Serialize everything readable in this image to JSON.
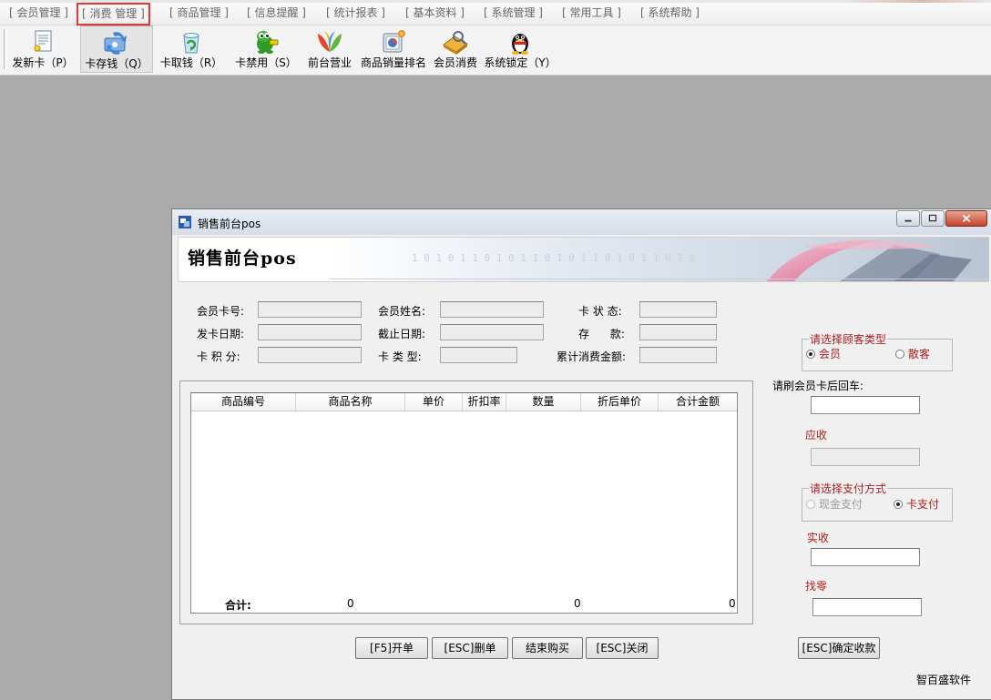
{
  "menu": [
    {
      "label": "[ 会员管理 ]",
      "active": false
    },
    {
      "label": "[ 消费 管理 ]",
      "active": true
    },
    {
      "label": "[ 商品管理 ]",
      "active": false
    },
    {
      "label": "[ 信息提醒 ]",
      "active": false
    },
    {
      "label": "[ 统计报表 ]",
      "active": false
    },
    {
      "label": "[ 基本资料 ]",
      "active": false
    },
    {
      "label": "[ 系统管理 ]",
      "active": false
    },
    {
      "label": "[ 常用工具 ]",
      "active": false
    },
    {
      "label": "[ 系统帮助 ]",
      "active": false
    }
  ],
  "toolbar": [
    {
      "label": "发新卡（P）",
      "icon": "new-card-icon"
    },
    {
      "label": "卡存钱（Q）",
      "icon": "card-deposit-icon"
    },
    {
      "label": "卡取钱（R）",
      "icon": "card-withdraw-icon"
    },
    {
      "label": "卡禁用（S）",
      "icon": "card-disable-icon"
    },
    {
      "label": "前台营业",
      "icon": "front-desk-icon"
    },
    {
      "label": "商品销量排名",
      "icon": "sales-ranking-icon"
    },
    {
      "label": "会员消费",
      "icon": "member-consume-icon"
    },
    {
      "label": "系统锁定（Y）",
      "icon": "system-lock-icon"
    }
  ],
  "window": {
    "title": "销售前台pos",
    "banner_title": "销售前台pos",
    "banner_digits": "1 0 1 0 1 1 0 1 0 1 1 0 1 0 1 1 0 1 0 1 1 0 1 0"
  },
  "fields": {
    "member_card_no": {
      "label": "会员卡号:",
      "value": ""
    },
    "member_name": {
      "label": "会员姓名:",
      "value": ""
    },
    "card_status": {
      "label": "卡 状 态:",
      "value": ""
    },
    "issue_date": {
      "label": "发卡日期:",
      "value": ""
    },
    "expiry_date": {
      "label": "截止日期:",
      "value": ""
    },
    "deposit": {
      "label": "存      款:",
      "value": ""
    },
    "card_points": {
      "label": "卡 积 分:",
      "value": ""
    },
    "card_type": {
      "label": "卡 类 型:",
      "value": ""
    },
    "total_spent": {
      "label": "累计消费金额:",
      "value": ""
    }
  },
  "grid": {
    "columns": [
      "商品编号",
      "商品名称",
      "单价",
      "折扣率",
      "数量",
      "折后单价",
      "合计金额"
    ],
    "rows": [],
    "total_label": "合计:",
    "total_qty": "0",
    "total_discount_price": "0",
    "total_amount": "0"
  },
  "customer_type": {
    "caption": "请选择顾客类型",
    "options": [
      {
        "label": "会员",
        "checked": true
      },
      {
        "label": "散客",
        "checked": false
      }
    ]
  },
  "swipe_label": "请刷会员卡后回车:",
  "receivable_label": "应收",
  "payment": {
    "caption": "请选择支付方式",
    "options": [
      {
        "label": "现金支付",
        "checked": false,
        "enabled": false
      },
      {
        "label": "卡支付",
        "checked": true,
        "enabled": true
      }
    ]
  },
  "paid_label": "实收",
  "change_label": "找零",
  "buttons": {
    "open_bill": "[F5]开单",
    "delete_bill": "[ESC]删单",
    "finish": "结束购买",
    "close": "[ESC]关闭",
    "confirm": "[ESC]确定收款"
  },
  "brand": "智百盛软件"
}
